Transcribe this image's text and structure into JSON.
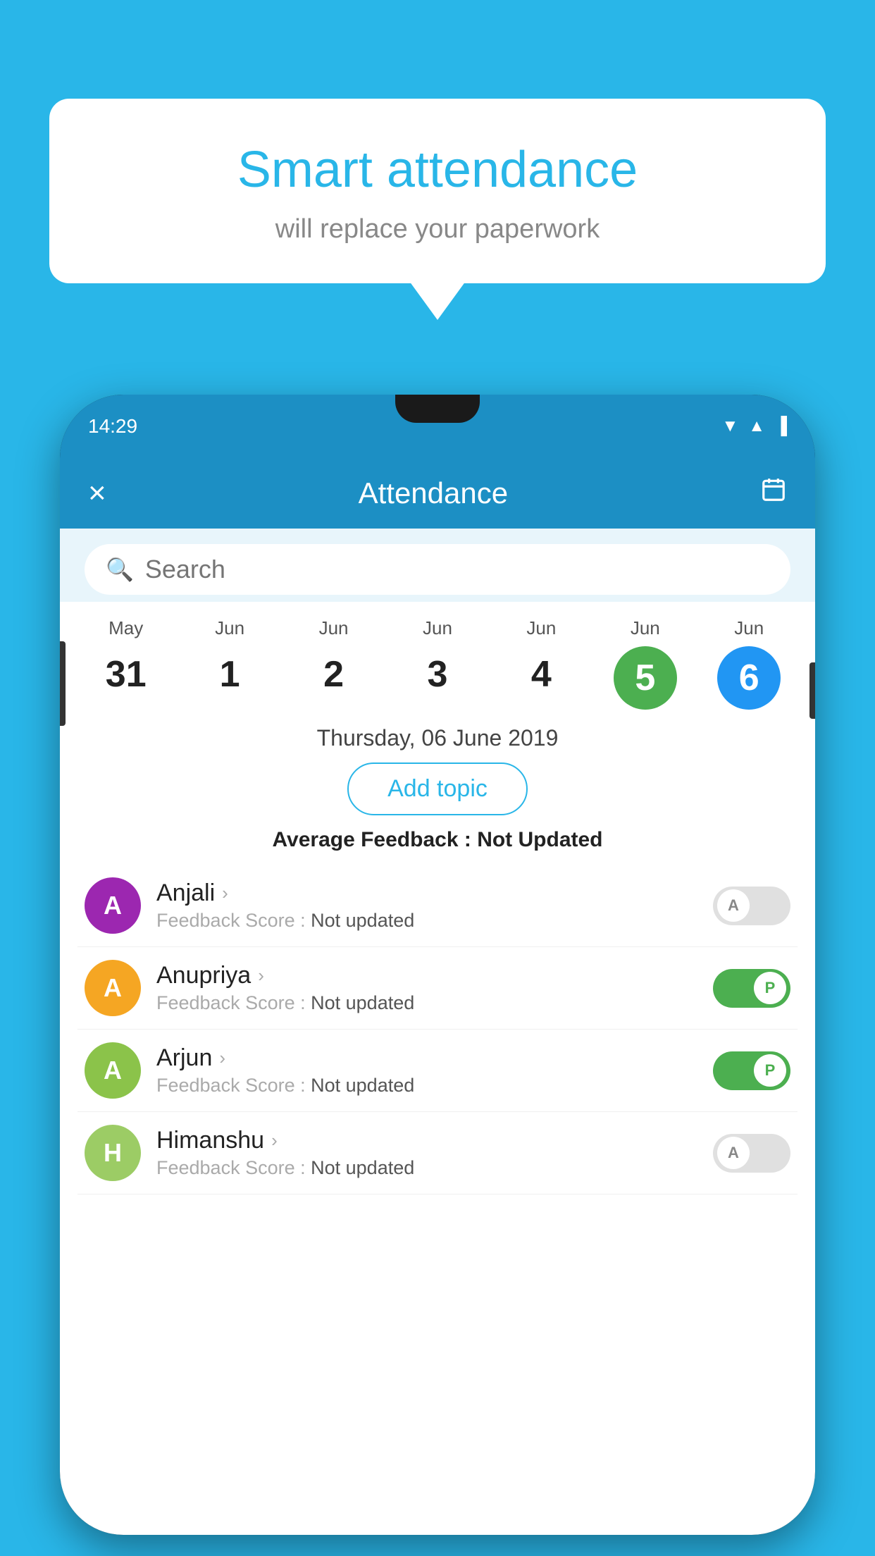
{
  "background_color": "#29b6e8",
  "speech_bubble": {
    "title": "Smart attendance",
    "subtitle": "will replace your paperwork"
  },
  "phone": {
    "status_bar": {
      "time": "14:29"
    },
    "header": {
      "title": "Attendance",
      "close_label": "×",
      "calendar_icon": "📅"
    },
    "search": {
      "placeholder": "Search"
    },
    "calendar": {
      "days": [
        {
          "month": "May",
          "day": "31",
          "state": "normal"
        },
        {
          "month": "Jun",
          "day": "1",
          "state": "normal"
        },
        {
          "month": "Jun",
          "day": "2",
          "state": "normal"
        },
        {
          "month": "Jun",
          "day": "3",
          "state": "normal"
        },
        {
          "month": "Jun",
          "day": "4",
          "state": "normal"
        },
        {
          "month": "Jun",
          "day": "5",
          "state": "active-green"
        },
        {
          "month": "Jun",
          "day": "6",
          "state": "active-blue"
        }
      ]
    },
    "selected_date": "Thursday, 06 June 2019",
    "add_topic_label": "Add topic",
    "avg_feedback_label": "Average Feedback :",
    "avg_feedback_value": "Not Updated",
    "students": [
      {
        "name": "Anjali",
        "avatar_letter": "A",
        "avatar_color": "#9c27b0",
        "feedback_label": "Feedback Score :",
        "feedback_value": "Not updated",
        "toggle": "off",
        "toggle_letter": "A"
      },
      {
        "name": "Anupriya",
        "avatar_letter": "A",
        "avatar_color": "#f5a623",
        "feedback_label": "Feedback Score :",
        "feedback_value": "Not updated",
        "toggle": "on",
        "toggle_letter": "P"
      },
      {
        "name": "Arjun",
        "avatar_letter": "A",
        "avatar_color": "#8bc34a",
        "feedback_label": "Feedback Score :",
        "feedback_value": "Not updated",
        "toggle": "on",
        "toggle_letter": "P"
      },
      {
        "name": "Himanshu",
        "avatar_letter": "H",
        "avatar_color": "#9ccc65",
        "feedback_label": "Feedback Score :",
        "feedback_value": "Not updated",
        "toggle": "off",
        "toggle_letter": "A"
      }
    ]
  }
}
